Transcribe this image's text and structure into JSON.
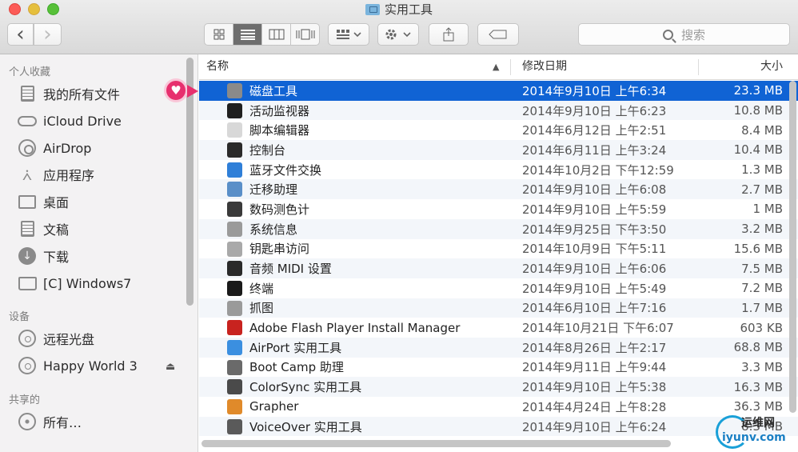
{
  "window": {
    "title": "实用工具"
  },
  "toolbar": {
    "back": "‹",
    "forward": "›",
    "search_placeholder": "搜索"
  },
  "sidebar": {
    "sections": {
      "favorites": "个人收藏",
      "devices": "设备",
      "shared": "共享的"
    },
    "favorites": [
      {
        "label": "我的所有文件",
        "icon": "all-files-icon"
      },
      {
        "label": "iCloud Drive",
        "icon": "cloud-icon"
      },
      {
        "label": "AirDrop",
        "icon": "airdrop-icon"
      },
      {
        "label": "应用程序",
        "icon": "applications-icon"
      },
      {
        "label": "桌面",
        "icon": "desktop-icon"
      },
      {
        "label": "文稿",
        "icon": "documents-icon"
      },
      {
        "label": "下载",
        "icon": "downloads-icon"
      },
      {
        "label": "[C] Windows7",
        "icon": "folder-icon"
      }
    ],
    "devices": [
      {
        "label": "远程光盘",
        "icon": "disc-icon"
      },
      {
        "label": "Happy World 3",
        "icon": "disc-icon"
      }
    ],
    "shared": [
      {
        "label": "所有…",
        "icon": "network-icon"
      }
    ]
  },
  "columns": {
    "name": "名称",
    "date": "修改日期",
    "size": "大小"
  },
  "files": [
    {
      "name": "磁盘工具",
      "date": "2014年9月10日 上午6:34",
      "size": "23.3 MB",
      "icon": "disk-utility-icon",
      "color": "#8a8a8a"
    },
    {
      "name": "活动监视器",
      "date": "2014年9月10日 上午6:23",
      "size": "10.8 MB",
      "icon": "activity-monitor-icon",
      "color": "#1f1f1f"
    },
    {
      "name": "脚本编辑器",
      "date": "2014年6月12日 上午2:51",
      "size": "8.4 MB",
      "icon": "script-editor-icon",
      "color": "#d8d8d8"
    },
    {
      "name": "控制台",
      "date": "2014年6月11日 上午3:24",
      "size": "10.4 MB",
      "icon": "console-icon",
      "color": "#2a2a2a"
    },
    {
      "name": "蓝牙文件交换",
      "date": "2014年10月2日 下午12:59",
      "size": "1.3 MB",
      "icon": "bluetooth-icon",
      "color": "#2f7fd8"
    },
    {
      "name": "迁移助理",
      "date": "2014年9月10日 上午6:08",
      "size": "2.7 MB",
      "icon": "migration-icon",
      "color": "#5a8fc8"
    },
    {
      "name": "数码测色计",
      "date": "2014年9月10日 上午5:59",
      "size": "1 MB",
      "icon": "color-meter-icon",
      "color": "#3a3a3a"
    },
    {
      "name": "系统信息",
      "date": "2014年9月25日 下午3:50",
      "size": "3.2 MB",
      "icon": "system-info-icon",
      "color": "#9a9a9a"
    },
    {
      "name": "钥匙串访问",
      "date": "2014年10月9日 下午5:11",
      "size": "15.6 MB",
      "icon": "keychain-icon",
      "color": "#a9a9a9"
    },
    {
      "name": "音频 MIDI 设置",
      "date": "2014年9月10日 上午6:06",
      "size": "7.5 MB",
      "icon": "midi-icon",
      "color": "#2a2a2a"
    },
    {
      "name": "终端",
      "date": "2014年9月10日 上午5:49",
      "size": "7.2 MB",
      "icon": "terminal-icon",
      "color": "#1a1a1a"
    },
    {
      "name": "抓图",
      "date": "2014年6月10日 上午7:16",
      "size": "1.7 MB",
      "icon": "grab-icon",
      "color": "#9a9a9a"
    },
    {
      "name": "Adobe Flash Player Install Manager",
      "date": "2014年10月21日 下午6:07",
      "size": "603 KB",
      "icon": "flash-icon",
      "color": "#c8231f"
    },
    {
      "name": "AirPort 实用工具",
      "date": "2014年8月26日 上午2:17",
      "size": "68.8 MB",
      "icon": "airport-icon",
      "color": "#3b8fe0"
    },
    {
      "name": "Boot Camp 助理",
      "date": "2014年9月11日 上午9:44",
      "size": "3.3 MB",
      "icon": "boot-camp-icon",
      "color": "#6a6a6a"
    },
    {
      "name": "ColorSync 实用工具",
      "date": "2014年9月10日 上午5:38",
      "size": "16.3 MB",
      "icon": "colorsync-icon",
      "color": "#4a4a4a"
    },
    {
      "name": "Grapher",
      "date": "2014年4月24日 上午8:28",
      "size": "36.3 MB",
      "icon": "grapher-icon",
      "color": "#e08a2a"
    },
    {
      "name": "VoiceOver 实用工具",
      "date": "2014年9月10日 上午6:24",
      "size": "8.3 MB",
      "icon": "voiceover-icon",
      "color": "#5a5a5a"
    }
  ],
  "watermark": {
    "brand": "运维网",
    "url": "iyunv.com"
  }
}
